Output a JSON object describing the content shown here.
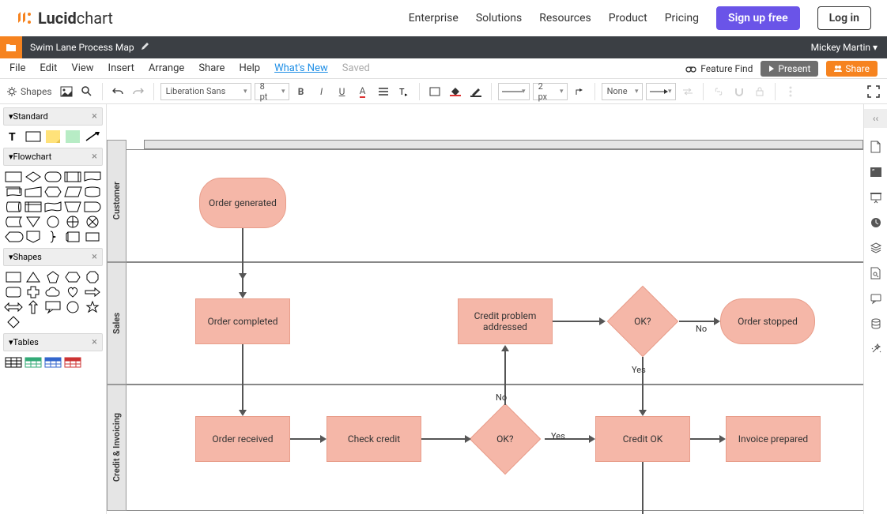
{
  "site": {
    "logo_bold": "Lucid",
    "logo_rest": "chart",
    "nav": [
      "Enterprise",
      "Solutions",
      "Resources",
      "Product",
      "Pricing"
    ],
    "signup": "Sign up free",
    "login": "Log in"
  },
  "doc": {
    "title": "Swim Lane Process Map",
    "user": "Mickey Martin ▾"
  },
  "menu": {
    "items": [
      "File",
      "Edit",
      "View",
      "Insert",
      "Arrange",
      "Share",
      "Help"
    ],
    "whats_new": "What's New",
    "saved": "Saved",
    "feature_find": "Feature Find",
    "present": "Present",
    "share": "Share"
  },
  "toolbar": {
    "shapes": "Shapes",
    "font": "Liberation Sans",
    "size": "8 pt",
    "line_w": "2 px",
    "line_end": "None"
  },
  "panels": {
    "standard": "Standard",
    "flowchart": "Flowchart",
    "shapes": "Shapes",
    "tables": "Tables"
  },
  "lanes": {
    "l1": "Customer",
    "l2": "Sales",
    "l3": "Credit & Invoicing"
  },
  "nodes": {
    "order_generated": "Order generated",
    "order_completed": "Order completed",
    "credit_problem": "Credit problem addressed",
    "ok1": "OK?",
    "order_stopped": "Order stopped",
    "order_received": "Order received",
    "check_credit": "Check credit",
    "ok2": "OK?",
    "credit_ok": "Credit OK",
    "invoice_prepared": "Invoice prepared"
  },
  "edge": {
    "no": "No",
    "yes": "Yes"
  }
}
